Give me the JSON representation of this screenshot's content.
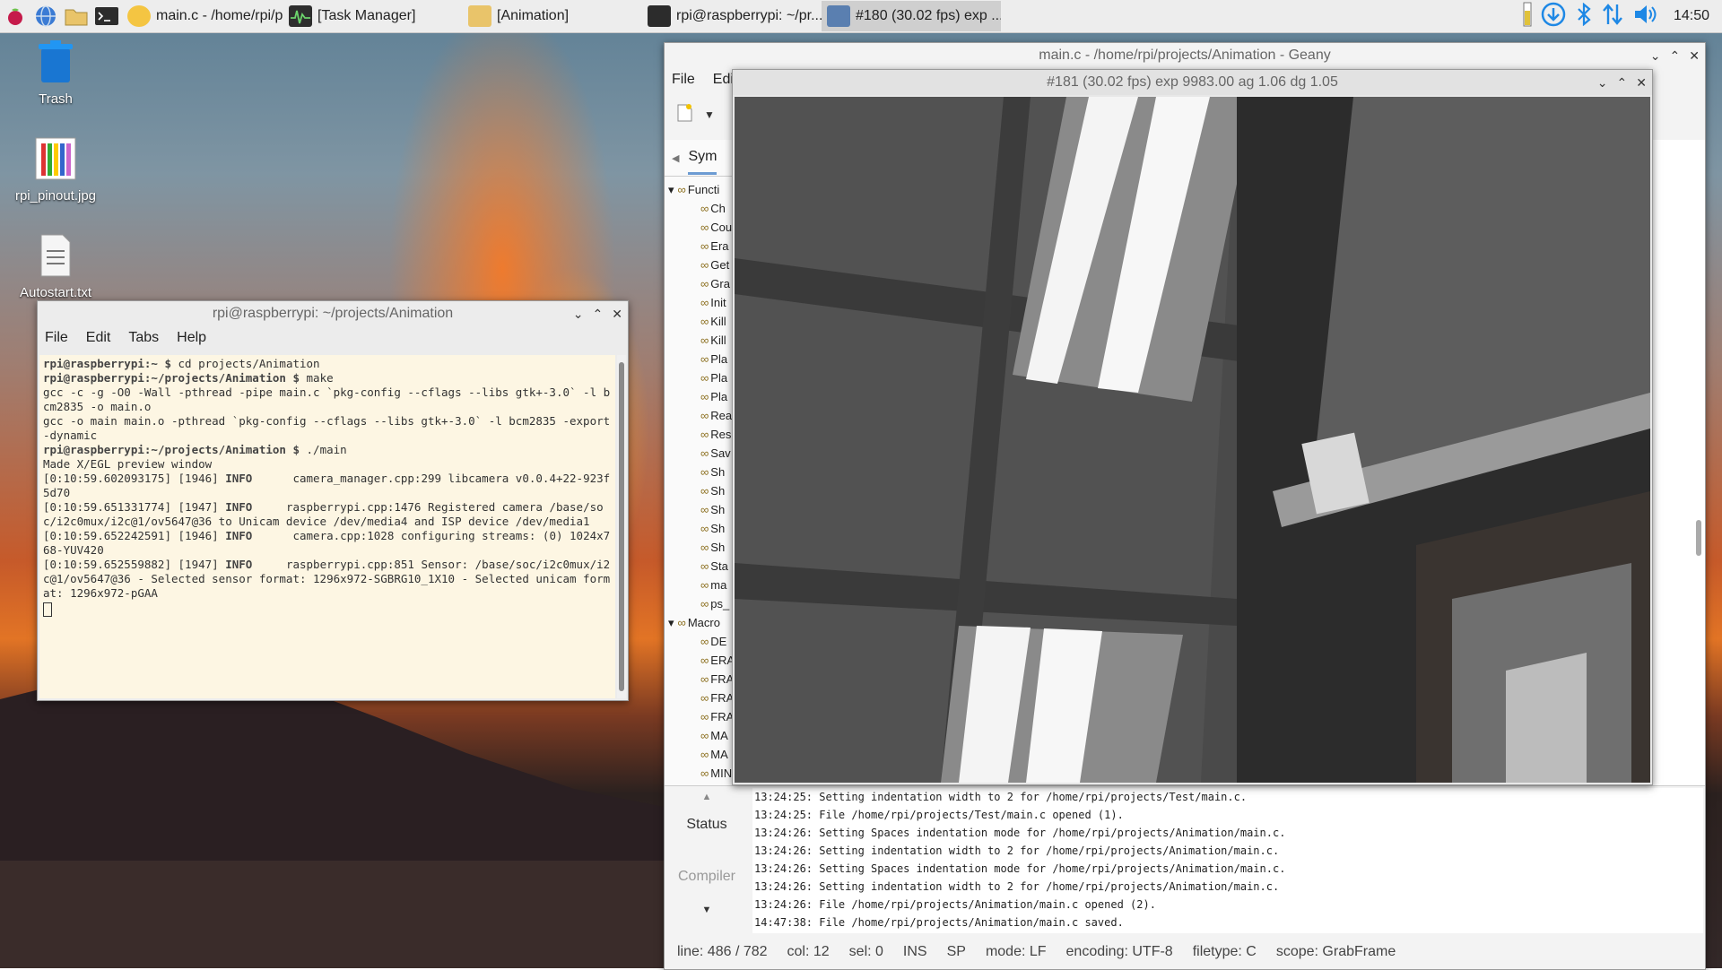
{
  "taskbar": {
    "tasks": [
      {
        "label": "main.c - /home/rpi/pr...",
        "active": false
      },
      {
        "label": "[Task Manager]",
        "active": false
      },
      {
        "label": "[Animation]",
        "active": false
      },
      {
        "label": "rpi@raspberrypi: ~/pr...",
        "active": false
      },
      {
        "label": "#180 (30.02 fps) exp ...",
        "active": true
      }
    ],
    "clock": "14:50"
  },
  "desktop_icons": [
    {
      "label": "Trash"
    },
    {
      "label": "rpi_pinout.jpg"
    },
    {
      "label": "Autostart.txt"
    }
  ],
  "terminal": {
    "title": "rpi@raspberrypi: ~/projects/Animation",
    "menu": [
      "File",
      "Edit",
      "Tabs",
      "Help"
    ],
    "lines": [
      {
        "prompt": "rpi@raspberrypi",
        "path": ":~ $ ",
        "cmd": "cd projects/Animation"
      },
      {
        "prompt": "rpi@raspberrypi",
        "path": ":~/projects/Animation $ ",
        "cmd": "make"
      },
      {
        "text": "gcc -c -g -O0 -Wall -pthread -pipe main.c `pkg-config --cflags --libs gtk+-3.0` -l bcm2835 -o main.o"
      },
      {
        "text": "gcc -o main main.o -pthread `pkg-config --cflags --libs gtk+-3.0` -l bcm2835 -export-dynamic"
      },
      {
        "prompt": "rpi@raspberrypi",
        "path": ":~/projects/Animation $ ",
        "cmd": "./main"
      },
      {
        "text": "Made X/EGL preview window"
      },
      {
        "ts": "[0:10:59.602093175] [1946]",
        "level": "INFO",
        "text": "      camera_manager.cpp:299 libcamera v0.0.4+22-923f5d70"
      },
      {
        "ts": "[0:10:59.651331774] [1947]",
        "level": "INFO",
        "text": "     raspberrypi.cpp:1476 Registered camera /base/soc/i2c0mux/i2c@1/ov5647@36 to Unicam device /dev/media4 and ISP device /dev/media1"
      },
      {
        "ts": "[0:10:59.652242591] [1946]",
        "level": "INFO",
        "text": "      camera.cpp:1028 configuring streams: (0) 1024x768-YUV420"
      },
      {
        "ts": "[0:10:59.652559882] [1947]",
        "level": "INFO",
        "text": "     raspberrypi.cpp:851 Sensor: /base/soc/i2c0mux/i2c@1/ov5647@36 - Selected sensor format: 1296x972-SGBRG10_1X10 - Selected unicam format: 1296x972-pGAA"
      }
    ]
  },
  "geany": {
    "title": "main.c - /home/rpi/projects/Animation - Geany",
    "menu": [
      "File",
      "Edit"
    ],
    "sidebar_tab": "Sym",
    "tree": [
      {
        "label": "Functi",
        "group": true
      },
      {
        "label": "Ch"
      },
      {
        "label": "Cou"
      },
      {
        "label": "Era"
      },
      {
        "label": "Get"
      },
      {
        "label": "Gra"
      },
      {
        "label": "Init"
      },
      {
        "label": "Kill"
      },
      {
        "label": "Kill"
      },
      {
        "label": "Pla"
      },
      {
        "label": "Pla"
      },
      {
        "label": "Pla"
      },
      {
        "label": "Rea"
      },
      {
        "label": "Res"
      },
      {
        "label": "Sav"
      },
      {
        "label": "Sh"
      },
      {
        "label": "Sh"
      },
      {
        "label": "Sh"
      },
      {
        "label": "Sh"
      },
      {
        "label": "Sh"
      },
      {
        "label": "Sta"
      },
      {
        "label": "ma"
      },
      {
        "label": "ps_"
      },
      {
        "label": "Macro",
        "group": true
      },
      {
        "label": "DE"
      },
      {
        "label": "ERA"
      },
      {
        "label": "FRA"
      },
      {
        "label": "FRA"
      },
      {
        "label": "FRA"
      },
      {
        "label": "MA"
      },
      {
        "label": "MA"
      },
      {
        "label": "MIN"
      }
    ],
    "msg_tabs": [
      "Status",
      "Compiler"
    ],
    "messages": [
      "13:24:25: Setting indentation width to 2 for /home/rpi/projects/Test/main.c.",
      "13:24:25: File /home/rpi/projects/Test/main.c opened (1).",
      "13:24:26: Setting Spaces indentation mode for /home/rpi/projects/Animation/main.c.",
      "13:24:26: Setting indentation width to 2 for /home/rpi/projects/Animation/main.c.",
      "13:24:26: Setting Spaces indentation mode for /home/rpi/projects/Animation/main.c.",
      "13:24:26: Setting indentation width to 2 for /home/rpi/projects/Animation/main.c.",
      "13:24:26: File /home/rpi/projects/Animation/main.c opened (2).",
      "14:47:38: File /home/rpi/projects/Animation/main.c saved."
    ],
    "status": {
      "line": "line: 486 / 782",
      "col": "col: 12",
      "sel": "sel: 0",
      "ins": "INS",
      "sp": "SP",
      "mode": "mode: LF",
      "encoding": "encoding: UTF-8",
      "filetype": "filetype: C",
      "scope": "scope: GrabFrame"
    }
  },
  "preview": {
    "title": "#181 (30.02 fps) exp 9983.00 ag 1.06 dg 1.05"
  }
}
